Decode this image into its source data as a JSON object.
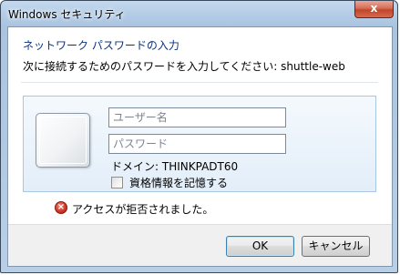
{
  "window": {
    "title": "Windows セキュリティ",
    "close_label": "x"
  },
  "dialog": {
    "heading": "ネットワーク パスワードの入力",
    "prompt": "次に接続するためのパスワードを入力してください: shuttle-web",
    "username_placeholder": "ユーザー名",
    "password_placeholder": "パスワード",
    "domain_text": "ドメイン: THINKPADT60",
    "remember_label": "資格情報を記憶する",
    "remember_checked": false,
    "error_text": "アクセスが拒否されました。"
  },
  "buttons": {
    "ok_label": "OK",
    "cancel_label": "キャンセル"
  },
  "colors": {
    "heading": "#0c327e",
    "close_button": "#c1452b",
    "error_icon": "#d23a2a"
  },
  "icons": {
    "error": "error-icon",
    "close": "close-icon",
    "user_tile": "user-tile-icon"
  }
}
